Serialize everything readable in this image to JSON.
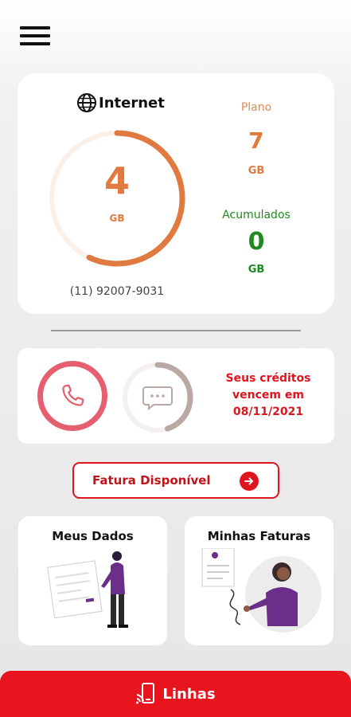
{
  "menu": {
    "icon": "hamburger-menu-icon"
  },
  "internet": {
    "title": "Internet",
    "icon": "globe-icon",
    "remaining_value": "4",
    "remaining_unit": "GB",
    "usage_fraction_remaining": 0.57,
    "phone_number": "(11) 92007-9031",
    "plano_label": "Plano",
    "plano_value": "7",
    "plano_unit": "GB",
    "acumulados_label": "Acumulados",
    "acumulados_value": "0",
    "acumulados_unit": "GB",
    "colors": {
      "primary": "#e07a3f",
      "track": "#fbf0e8",
      "green": "#1f8a1f"
    }
  },
  "credits": {
    "call_icon": "phone-icon",
    "sms_icon": "chat-bubble-icon",
    "sms_fraction": 0.45,
    "line1": "Seus créditos",
    "line2": "vencem em",
    "line3": "08/11/2021",
    "colors": {
      "call": "#e55f6f",
      "sms": "#b9a8a4",
      "text": "#e0141e"
    }
  },
  "invoice_button": {
    "label": "Fatura Disponível",
    "icon": "arrow-right-circle-icon"
  },
  "cards": {
    "dados": {
      "title": "Meus Dados"
    },
    "faturas": {
      "title": "Minhas Faturas"
    }
  },
  "bottom_bar": {
    "label": "Linhas",
    "icon": "phone-lines-icon"
  }
}
